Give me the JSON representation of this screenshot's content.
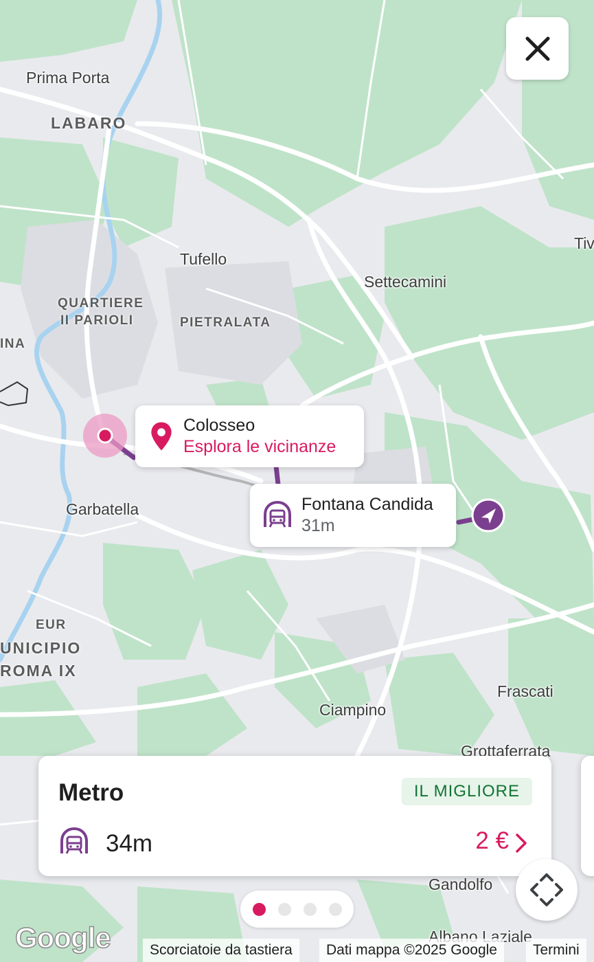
{
  "map": {
    "places": [
      {
        "id": "prima-porta",
        "label": "Prima Porta"
      },
      {
        "id": "tufello",
        "label": "Tufello"
      },
      {
        "id": "settecamini",
        "label": "Settecamini"
      },
      {
        "id": "tivoli",
        "label": "Tiv"
      },
      {
        "id": "garbatella",
        "label": "Garbatella"
      },
      {
        "id": "ciampino",
        "label": "Ciampino"
      },
      {
        "id": "frascati",
        "label": "Frascati"
      },
      {
        "id": "grottaferrata",
        "label": "Grottaferrata"
      },
      {
        "id": "gandolfo",
        "label": "Gandolfo"
      },
      {
        "id": "albano",
        "label": "Albano Laziale"
      }
    ],
    "districts": {
      "labaro": "LABARO",
      "quartiere_line1": "QUARTIERE",
      "quartiere_line2": "II PARIOLI",
      "pietralata": "PIETRALATA",
      "ina": "INA",
      "eur": "EUR",
      "municipio_line1": "UNICIPIO",
      "municipio_line2": "ROMA IX"
    },
    "colors": {
      "land": "#e9eaee",
      "park": "#bfe3c9",
      "road": "#ffffff",
      "water": "#a8d3f0",
      "route": "#7b3f8f",
      "accent": "#d81b60"
    }
  },
  "destination_callout": {
    "icon": "map-pin-icon",
    "name": "Colosseo",
    "action": "Esplora le vicinanze"
  },
  "station_callout": {
    "icon": "metro-icon",
    "name": "Fontana Candida",
    "duration": "31m"
  },
  "route_card": {
    "mode": "Metro",
    "badge": "IL MIGLIORE",
    "icon": "metro-icon",
    "duration": "34m",
    "price": "2 €",
    "chevron": "chevron-right-icon"
  },
  "pager": {
    "pages": 4,
    "active_index": 0
  },
  "attribution": {
    "logo": "Google",
    "shortcuts": "Scorciatoie da tastiera",
    "map_data": "Dati mappa ©2025 Google",
    "terms": "Termini"
  }
}
